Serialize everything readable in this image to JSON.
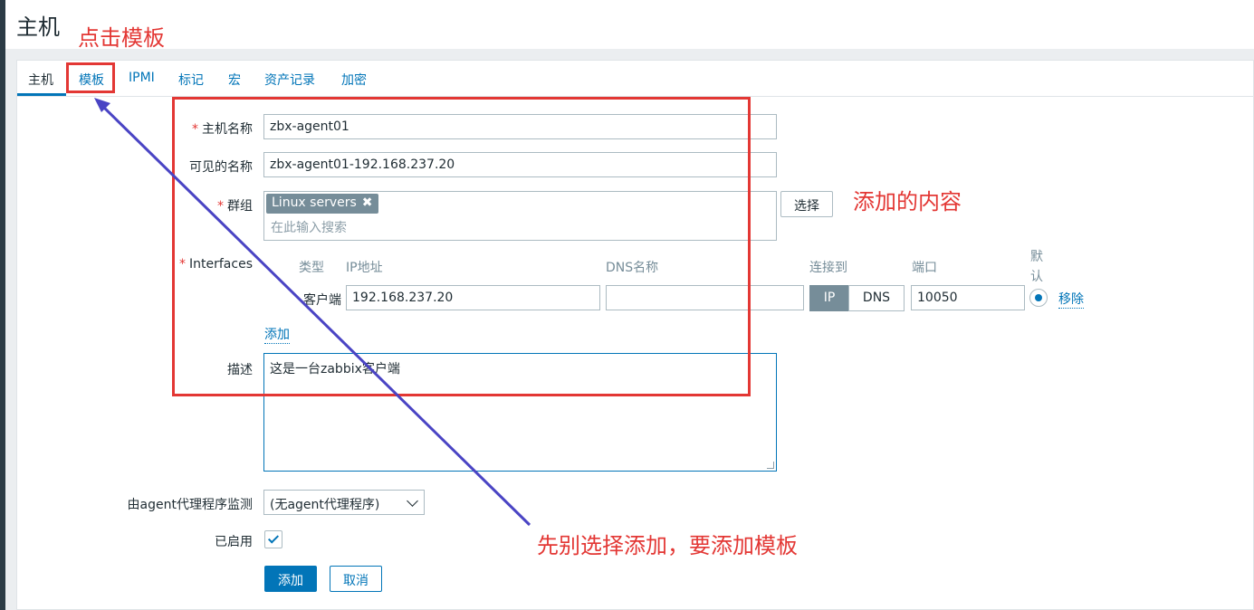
{
  "page": {
    "title": "主机"
  },
  "tabs": [
    {
      "label": "主机"
    },
    {
      "label": "模板"
    },
    {
      "label": "IPMI"
    },
    {
      "label": "标记"
    },
    {
      "label": "宏"
    },
    {
      "label": "资产记录"
    },
    {
      "label": "加密"
    }
  ],
  "form": {
    "hostname_label": "主机名称",
    "hostname_value": "zbx-agent01",
    "visible_name_label": "可见的名称",
    "visible_name_value": "zbx-agent01-192.168.237.20",
    "groups_label": "群组",
    "group_chip": "Linux servers",
    "group_chip_remove": "✖",
    "groups_placeholder": "在此输入搜索",
    "select_button": "选择",
    "interfaces_label": "Interfaces",
    "interfaces_cols": {
      "type": "类型",
      "ip": "IP地址",
      "dns": "DNS名称",
      "connect": "连接到",
      "port": "端口",
      "default": "默认"
    },
    "interface_row": {
      "type": "客户端",
      "ip": "192.168.237.20",
      "dns": "",
      "connect_ip": "IP",
      "connect_dns": "DNS",
      "port": "10050",
      "remove": "移除"
    },
    "add_interface": "添加",
    "description_label": "描述",
    "description_value": "这是一台zabbix客户端",
    "proxy_label": "由agent代理程序监测",
    "proxy_value": "(无agent代理程序)",
    "enabled_label": "已启用",
    "enabled_checked": true,
    "submit_button": "添加",
    "cancel_button": "取消"
  },
  "annotations": {
    "click_template": "点击模板",
    "added_content": "添加的内容",
    "note": "先别选择添加，要添加模板"
  },
  "colors": {
    "annotation": "#e33734",
    "arrow": "#4a44c4",
    "accent": "#0275b8"
  }
}
